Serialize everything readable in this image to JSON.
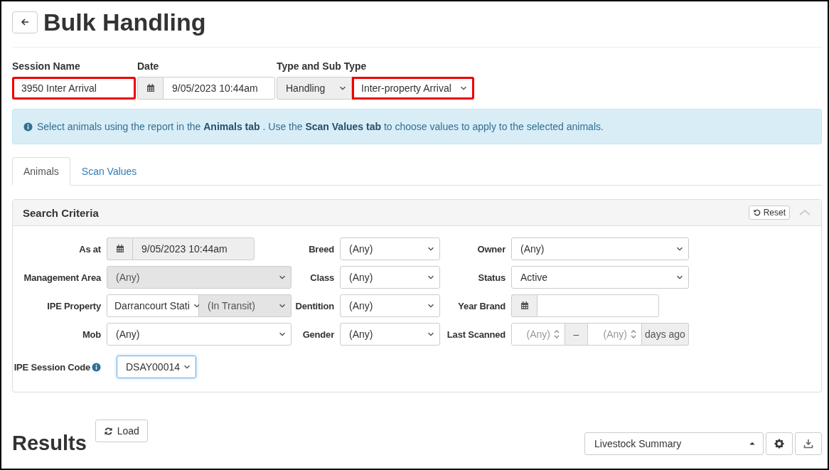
{
  "page": {
    "title": "Bulk Handling"
  },
  "session": {
    "name": {
      "label": "Session Name",
      "value": "3950 Inter Arrival",
      "highlighted": true
    },
    "date": {
      "label": "Date",
      "value": "9/05/2023 10:44am",
      "highlighted": false
    },
    "type": {
      "label": "Type and Sub Type",
      "type_value": "Handling",
      "subtype_value": "Inter-property Arrival",
      "type_highlighted": false,
      "subtype_highlighted": true
    }
  },
  "info_message": "Select animals using the report in the **Animals tab** . Use the **Scan Values tab** to choose values to apply to the selected animals.",
  "tabs": [
    {
      "label": "Animals",
      "selected": true
    },
    {
      "label": "Scan Values",
      "selected": false
    }
  ],
  "search_criteria": {
    "title": "Search Criteria",
    "reset_label": "Reset",
    "fields": [
      {
        "kind": "date",
        "label": "As at",
        "value": "9/05/2023 10:44am",
        "disabled": true
      },
      {
        "kind": "select",
        "label": "Breed",
        "value": "(Any)",
        "disabled": false
      },
      {
        "kind": "select",
        "label": "Owner",
        "value": "(Any)",
        "disabled": false
      },
      {
        "kind": "select",
        "label": "Management Area",
        "value": "(Any)",
        "disabled": true
      },
      {
        "kind": "select",
        "label": "Class",
        "value": "(Any)",
        "disabled": false
      },
      {
        "kind": "select",
        "label": "Status",
        "value": "Active",
        "disabled": false
      },
      {
        "kind": "select-pair",
        "label": "IPE Property",
        "value": "Darrancourt Stati",
        "value_2": "(In Transit)",
        "disabled": false,
        "disabled_2": true
      },
      {
        "kind": "select",
        "label": "Dentition",
        "value": "(Any)",
        "disabled": false
      },
      {
        "kind": "date",
        "label": "Year Brand",
        "disabled": false
      },
      {
        "kind": "select",
        "label": "Mob",
        "value": "(Any)",
        "disabled": false
      },
      {
        "kind": "select",
        "label": "Gender",
        "value": "(Any)",
        "disabled": false
      },
      {
        "kind": "range",
        "label": "Last Scanned",
        "placeholder": "(Any)",
        "placeholder_2": "(Any)",
        "separator": "–",
        "suffix": "days ago"
      },
      {
        "kind": "code-select",
        "label": "IPE Session Code",
        "value": "DSAY00014",
        "disabled": false
      }
    ]
  },
  "results": {
    "title": "Results",
    "load_label": "Load",
    "report": "Livestock Summary"
  }
}
